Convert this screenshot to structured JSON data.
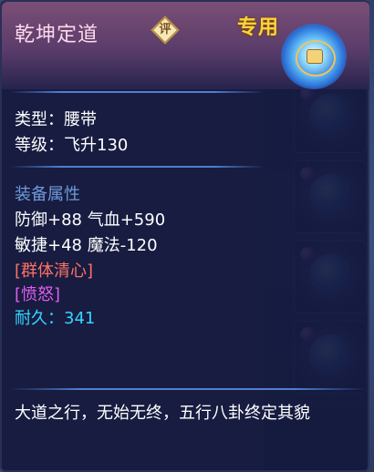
{
  "item": {
    "name": "乾坤定道",
    "rate_label": "评",
    "exclusive_label": "专用",
    "icon": "belt-icon",
    "type_line": "类型：腰带",
    "level_line": "等级：飞升130"
  },
  "attributes": {
    "heading": "装备属性",
    "stat_line_1": "防御+88 气血+590",
    "stat_line_2": "敏捷+48 魔法-120",
    "effect_1": "[群体清心]",
    "effect_2": "[愤怒]",
    "durability": "耐久：341"
  },
  "description": "大道之行，无始无终，五行八卦终定其貌",
  "colors": {
    "heading": "#6f9ad8",
    "effect_1": "#ff7266",
    "effect_2": "#e05cf0",
    "durability": "#35d6ff",
    "exclusive": "#ffd23a"
  }
}
